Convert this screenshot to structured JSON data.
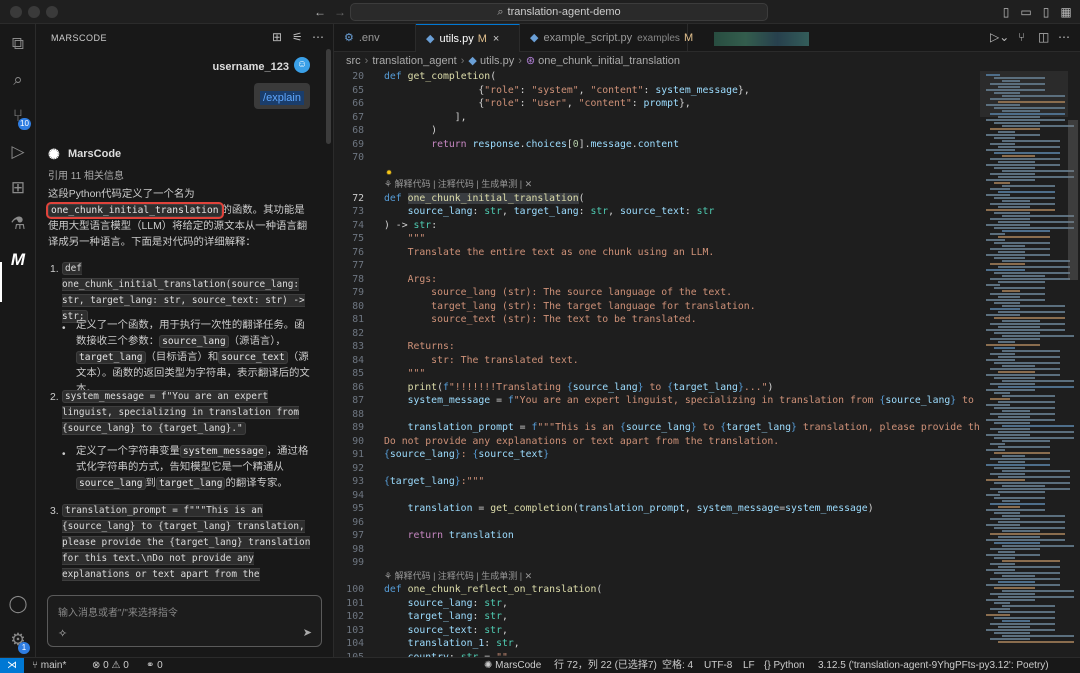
{
  "titlebar": {
    "search": "translation-agent-demo"
  },
  "activity": {
    "scm_badge": "10",
    "account_badge": "1"
  },
  "chat": {
    "panel_title": "MARSCODE",
    "username": "username_123",
    "explain_chip": "/explain",
    "ai_name": "MarsCode",
    "refs": "引用 11 相关信息",
    "intro_pre": "这段Python代码定义了一个名为",
    "intro_fn": "one_chunk_initial_translation",
    "intro_post": "的函数。其功能是使用大型语言模型（LLM）将给定的源文本从一种语言翻译成另一种语言。下面是对代码的详细解释：",
    "item1_code": "def one_chunk_initial_translation(source_lang: str, target_lang: str, source_text: str) -> str:",
    "item1_desc_a": "定义了一个函数，用于执行一次性的翻译任务。函数接收三个参数：",
    "item1_p1": "source_lang",
    "item1_p1d": "（源语言），",
    "item1_p2": "target_lang",
    "item1_p2d": "（目标语言）和",
    "item1_p3": "source_text",
    "item1_p3d": "（源文本）。函数的返回类型为字符串，表示翻译后的文本。",
    "item2_code": "system_message = f\"You are an expert linguist, specializing in translation from {source_lang} to {target_lang}.\"",
    "item2_desc_a": "定义了一个字符串变量",
    "item2_var": "system_message",
    "item2_desc_b": "，通过格式化字符串的方式，告知模型它是一个精通从",
    "item2_v1": "source_lang",
    "item2_mid": "到",
    "item2_v2": "target_lang",
    "item2_end": "的翻译专家。",
    "item3_code": "translation_prompt = f\"\"\"This is an {source_lang} to {target_lang} translation, please provide the {target_lang} translation for this text.\\nDo not provide any explanations or text apart from the translation.\\n{source_lang}: {sou",
    "input_placeholder": "输入消息或者\"/\"来选择指令"
  },
  "tabs": [
    {
      "label": ".env",
      "modified": ""
    },
    {
      "label": "utils.py",
      "modified": "M"
    },
    {
      "label": "example_script.py",
      "dir": "examples",
      "modified": "M"
    }
  ],
  "breadcrumb": [
    "src",
    "translation_agent",
    "utils.py",
    "one_chunk_initial_translation"
  ],
  "codelens": "解释代码 | 注释代码 | 生成单测 | ✕",
  "code_lines": [
    {
      "n": "20",
      "html": "<span class='k'>def</span> <span class='f'>get_completion</span>("
    },
    {
      "n": "65",
      "html": "                {<span class='s'>\"role\"</span>: <span class='s'>\"system\"</span>, <span class='s'>\"content\"</span>: <span class='p'>system_message</span>},"
    },
    {
      "n": "66",
      "html": "                {<span class='s'>\"role\"</span>: <span class='s'>\"user\"</span>, <span class='s'>\"content\"</span>: <span class='p'>prompt</span>},"
    },
    {
      "n": "67",
      "html": "            ],"
    },
    {
      "n": "68",
      "html": "        )"
    },
    {
      "n": "69",
      "html": "        <span class='kc'>return</span> <span class='p'>response</span>.<span class='p'>choices</span>[<span class='n'>0</span>].<span class='p'>message</span>.<span class='p'>content</span>"
    },
    {
      "n": "70",
      "html": ""
    },
    {
      "n": "",
      "lens": true
    },
    {
      "n": "72",
      "cur": true,
      "html": "<span class='k'>def</span> <span class='f sel'>one_chunk_initial_translation</span>("
    },
    {
      "n": "73",
      "html": "    <span class='p'>source_lang</span>: <span class='t'>str</span>, <span class='p'>target_lang</span>: <span class='t'>str</span>, <span class='p'>source_text</span>: <span class='t'>str</span>"
    },
    {
      "n": "74",
      "html": ") -> <span class='t'>str</span>:"
    },
    {
      "n": "75",
      "html": "    <span class='s'>\"\"\"</span>"
    },
    {
      "n": "76",
      "html": "<span class='s'>    Translate the entire text as one chunk using an LLM.</span>"
    },
    {
      "n": "77",
      "html": ""
    },
    {
      "n": "78",
      "html": "<span class='s'>    Args:</span>"
    },
    {
      "n": "79",
      "html": "<span class='s'>        source_lang (str): The source language of the text.</span>"
    },
    {
      "n": "80",
      "html": "<span class='s'>        target_lang (str): The target language for translation.</span>"
    },
    {
      "n": "81",
      "html": "<span class='s'>        source_text (str): The text to be translated.</span>"
    },
    {
      "n": "82",
      "html": ""
    },
    {
      "n": "83",
      "html": "<span class='s'>    Returns:</span>"
    },
    {
      "n": "84",
      "html": "<span class='s'>        str: The translated text.</span>"
    },
    {
      "n": "85",
      "html": "<span class='s'>    \"\"\"</span>"
    },
    {
      "n": "86",
      "html": "    <span class='f'>print</span>(<span class='b'>f</span><span class='s'>\"!!!!!!!Translating </span><span class='b'>{</span><span class='p'>source_lang</span><span class='b'>}</span><span class='s'> to </span><span class='b'>{</span><span class='p'>target_lang</span><span class='b'>}</span><span class='s'>...\"</span>)"
    },
    {
      "n": "87",
      "html": "    <span class='p'>system_message</span> = <span class='b'>f</span><span class='s'>\"You are an expert linguist, specializing in translation from </span><span class='b'>{</span><span class='p'>source_lang</span><span class='b'>}</span><span class='s'> to </span><span class='b'>{</span><span class='p'>target_l</span>"
    },
    {
      "n": "88",
      "html": ""
    },
    {
      "n": "89",
      "html": "    <span class='p'>translation_prompt</span> = <span class='b'>f</span><span class='s'>\"\"\"This is an </span><span class='b'>{</span><span class='p'>source_lang</span><span class='b'>}</span><span class='s'> to </span><span class='b'>{</span><span class='p'>target_lang</span><span class='b'>}</span><span class='s'> translation, please provide the </span><span class='b'>{</span><span class='p'>target</span>"
    },
    {
      "n": "90",
      "html": "<span class='s'>Do not provide any explanations or text apart from the translation.</span>"
    },
    {
      "n": "91",
      "html": "<span class='b'>{</span><span class='p'>source_lang</span><span class='b'>}</span><span class='s'>: </span><span class='b'>{</span><span class='p'>source_text</span><span class='b'>}</span>"
    },
    {
      "n": "92",
      "html": ""
    },
    {
      "n": "93",
      "html": "<span class='b'>{</span><span class='p'>target_lang</span><span class='b'>}</span><span class='s'>:\"\"\"</span>"
    },
    {
      "n": "94",
      "html": ""
    },
    {
      "n": "95",
      "html": "    <span class='p'>translation</span> = <span class='f'>get_completion</span>(<span class='p'>translation_prompt</span>, <span class='p'>system_message</span>=<span class='p'>system_message</span>)"
    },
    {
      "n": "96",
      "html": ""
    },
    {
      "n": "97",
      "html": "    <span class='kc'>return</span> <span class='p'>translation</span>"
    },
    {
      "n": "98",
      "html": ""
    },
    {
      "n": "99",
      "html": ""
    },
    {
      "n": "",
      "lens": true
    },
    {
      "n": "100",
      "html": "<span class='k'>def</span> <span class='f'>one_chunk_reflect_on_translation</span>("
    },
    {
      "n": "101",
      "html": "    <span class='p'>source_lang</span>: <span class='t'>str</span>,"
    },
    {
      "n": "102",
      "html": "    <span class='p'>target_lang</span>: <span class='t'>str</span>,"
    },
    {
      "n": "103",
      "html": "    <span class='p'>source_text</span>: <span class='t'>str</span>,"
    },
    {
      "n": "104",
      "html": "    <span class='p'>translation_1</span>: <span class='t'>str</span>,"
    },
    {
      "n": "105",
      "html": "    <span class='p'>country</span>: <span class='t'>str</span> = <span class='s'>\"\"</span>,"
    }
  ],
  "status": {
    "branch": "main*",
    "errors": "⊗ 0 ⚠ 0",
    "ports": "0",
    "marscode": "MarsCode",
    "position": "行 72，列 22 (已选择7)",
    "spaces": "空格: 4",
    "encoding": "UTF-8",
    "eol": "LF",
    "language": "Python",
    "interpreter": "3.12.5 ('translation-agent-9YhgPFts-py3.12': Poetry)"
  }
}
